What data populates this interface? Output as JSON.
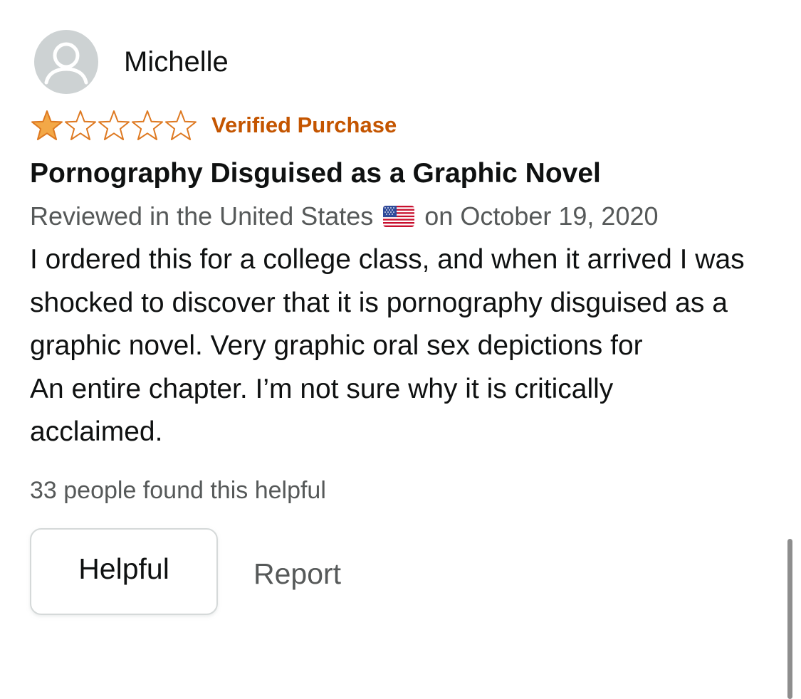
{
  "reviewer": {
    "name": "Michelle",
    "avatar_icon": "default-user-icon"
  },
  "rating": {
    "value": 1,
    "max": 5,
    "filled_color": "#f3a847",
    "empty_color": "#de7921"
  },
  "verified_label": "Verified Purchase",
  "title": "Pornography Disguised as a Graphic Novel",
  "meta": {
    "location_text": "Reviewed in the United States",
    "flag_icon": "us-flag-icon",
    "date_text": "on October 19, 2020"
  },
  "body": "I ordered this for a college class, and when it arrived I was shocked to discover that it is pornography disguised as a graphic novel. Very graphic oral sex depictions for\nAn entire chapter. I’m not sure why it is critically acclaimed.",
  "helpful_count_text": "33 people found this helpful",
  "actions": {
    "helpful_label": "Helpful",
    "report_label": "Report"
  },
  "colors": {
    "verified": "#c45500",
    "meta_text": "#565959",
    "text": "#0f1111"
  }
}
